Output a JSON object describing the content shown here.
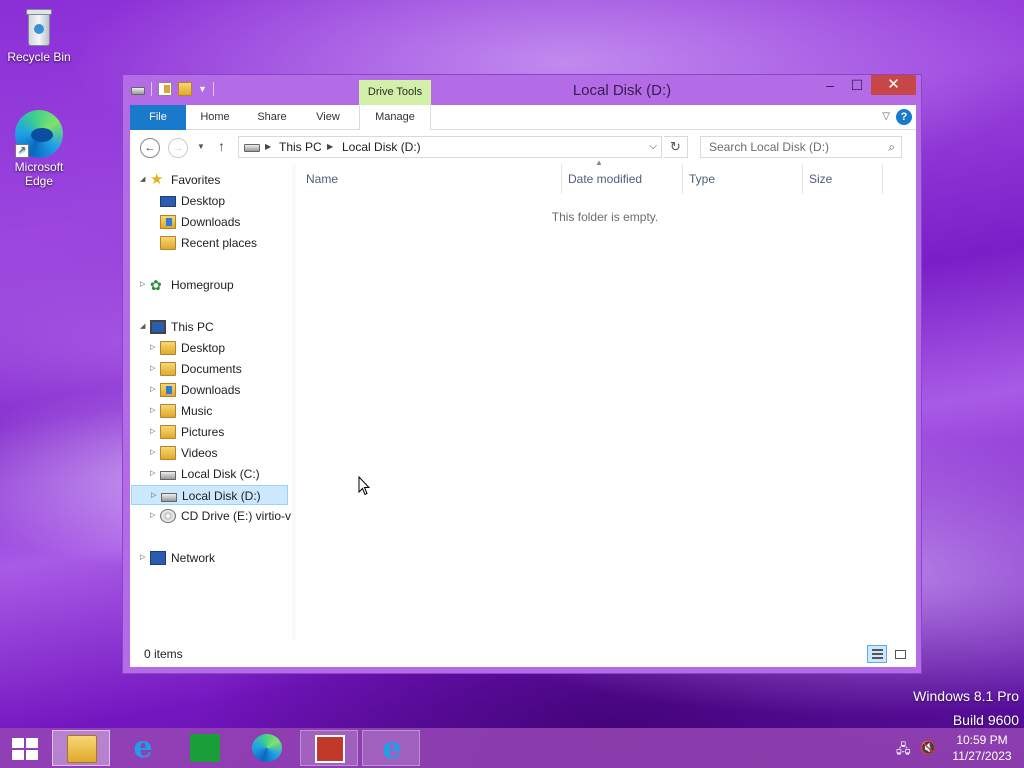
{
  "desktop": {
    "icons": [
      {
        "label": "Recycle Bin",
        "icon": "recycle-bin-icon"
      },
      {
        "label": "Microsoft Edge",
        "icon": "edge-icon"
      }
    ],
    "watermark": {
      "line1": "Windows 8.1 Pro",
      "line2": "Build 9600"
    }
  },
  "window": {
    "title": "Local Disk (D:)",
    "contextual_group": "Drive Tools",
    "controls": {
      "minimize": "–",
      "maximize": "☐",
      "close": "✕"
    },
    "ribbon_tabs": {
      "file": "File",
      "home": "Home",
      "share": "Share",
      "view": "View",
      "manage": "Manage"
    },
    "help": "?",
    "address": {
      "crumbs": [
        "This PC",
        "Local Disk (D:)"
      ]
    },
    "search": {
      "placeholder": "Search Local Disk (D:)"
    },
    "nav_tree": {
      "favorites": {
        "label": "Favorites",
        "children": [
          "Desktop",
          "Downloads",
          "Recent places"
        ]
      },
      "homegroup": "Homegroup",
      "this_pc": {
        "label": "This PC",
        "children": [
          "Desktop",
          "Documents",
          "Downloads",
          "Music",
          "Pictures",
          "Videos",
          "Local Disk (C:)",
          "Local Disk (D:)",
          "CD Drive (E:) virtio-v"
        ]
      },
      "network": "Network",
      "selected": "Local Disk (D:)"
    },
    "columns": [
      "Name",
      "Date modified",
      "Type",
      "Size"
    ],
    "empty_message": "This folder is empty.",
    "status": {
      "item_count": "0 items"
    }
  },
  "taskbar": {
    "apps": [
      {
        "name": "File Explorer",
        "icon": "folder-icon",
        "state": "active"
      },
      {
        "name": "Internet Explorer",
        "icon": "ie-icon",
        "state": "pinned"
      },
      {
        "name": "Store",
        "icon": "store-icon",
        "state": "pinned"
      },
      {
        "name": "Microsoft Edge",
        "icon": "edge-icon",
        "state": "pinned"
      },
      {
        "name": "App",
        "icon": "app-icon",
        "state": "running"
      },
      {
        "name": "Internet Explorer",
        "icon": "ie-icon",
        "state": "running"
      }
    ],
    "clock": {
      "time": "10:59 PM",
      "date": "11/27/2023"
    }
  },
  "colors": {
    "accent": "#1979ca",
    "window_frame": "#b36be6",
    "close": "#c74646",
    "drive_tools": "#d3f0a8",
    "selected": "#cce8ff"
  }
}
